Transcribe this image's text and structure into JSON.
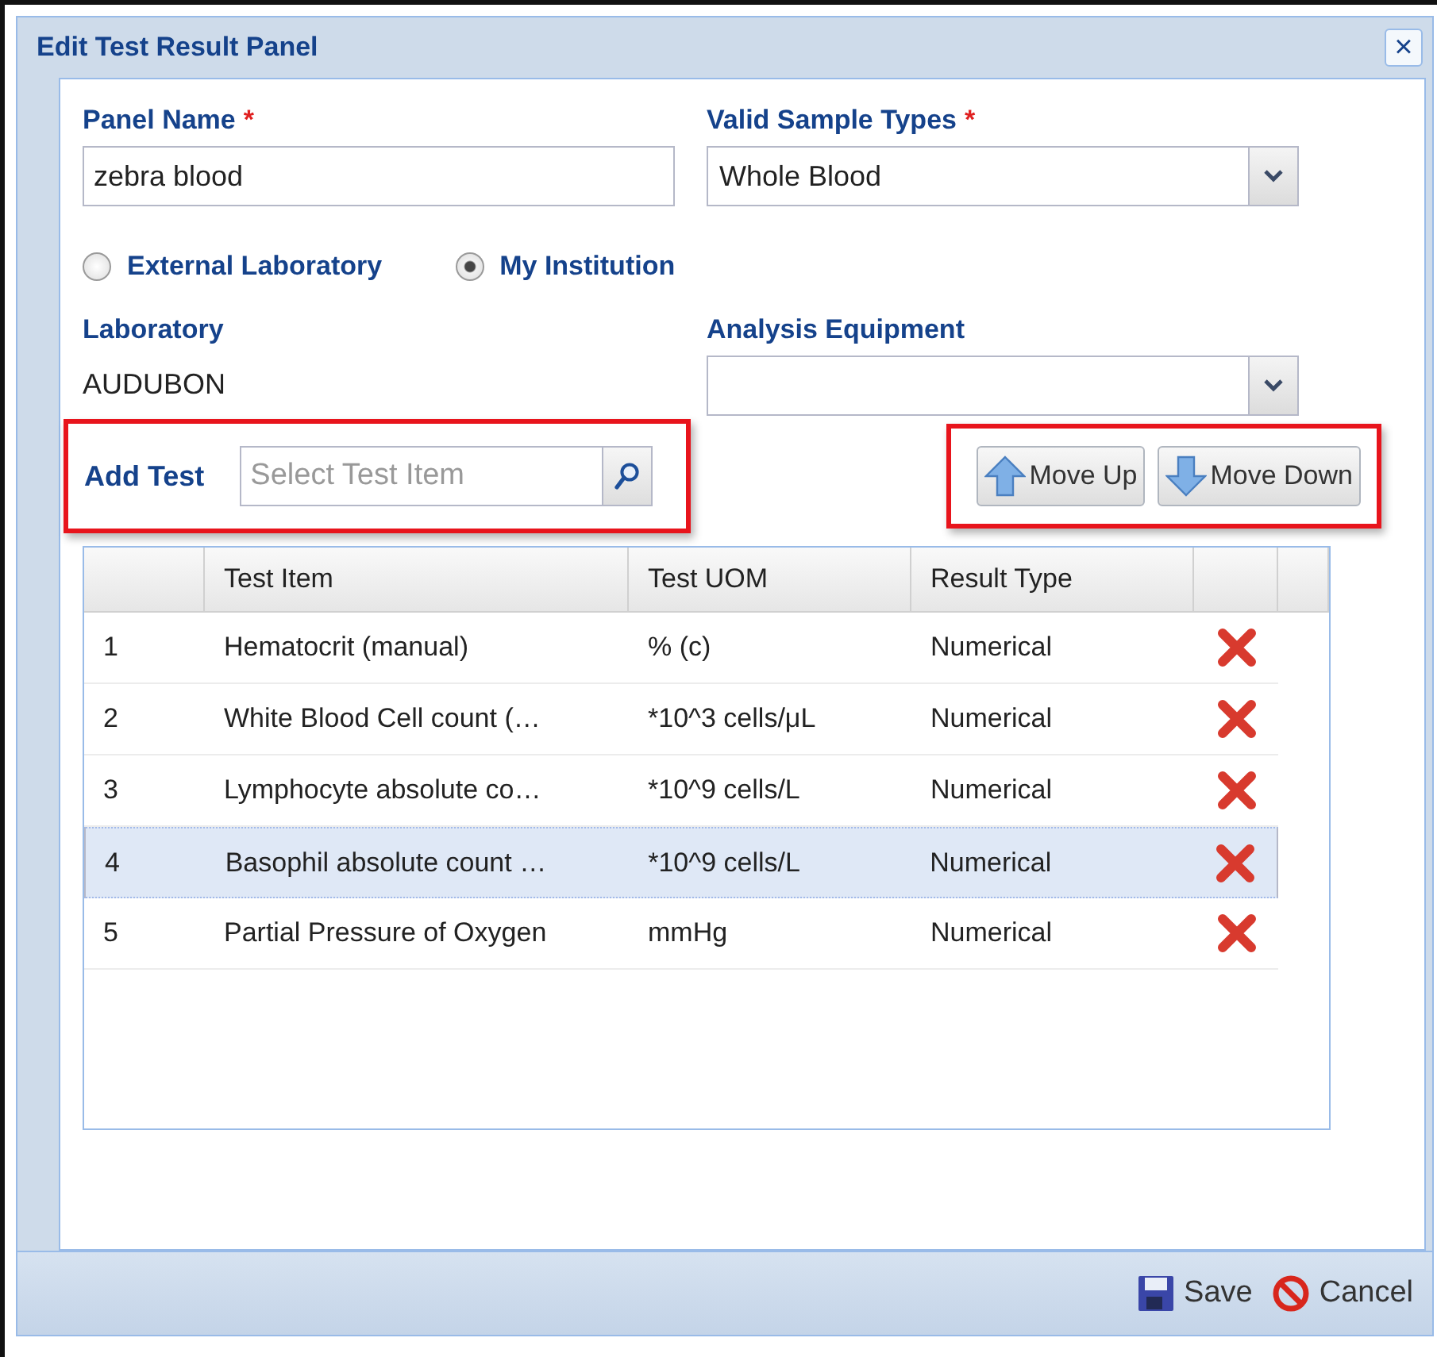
{
  "window": {
    "title": "Edit Test Result Panel",
    "close": "×"
  },
  "panel_name": {
    "label": "Panel Name",
    "required_mark": "*",
    "value": "zebra blood"
  },
  "sample_types": {
    "label": "Valid Sample Types",
    "required_mark": "*",
    "value": "Whole Blood"
  },
  "source": [
    {
      "label": "External Laboratory",
      "selected": false
    },
    {
      "label": "My Institution",
      "selected": true
    }
  ],
  "laboratory": {
    "label": "Laboratory",
    "value": "AUDUBON"
  },
  "equipment": {
    "label": "Analysis Equipment"
  },
  "add_test": {
    "label": "Add Test",
    "placeholder": "Select Test Item"
  },
  "move_buttons": [
    {
      "kind": "up",
      "label": "Move Up"
    },
    {
      "kind": "down",
      "label": "Move Down"
    }
  ],
  "table": {
    "columns": [
      "Test Item",
      "Test UOM",
      "Result Type"
    ],
    "rows": [
      {
        "index": "1",
        "test_item": "Hematocrit (manual)",
        "uom": "% (c)",
        "result_type": "Numerical",
        "selected": false
      },
      {
        "index": "2",
        "test_item": "White Blood Cell count (…",
        "uom": "*10^3 cells/μL",
        "result_type": "Numerical",
        "selected": false
      },
      {
        "index": "3",
        "test_item": "Lymphocyte absolute co…",
        "uom": "*10^9 cells/L",
        "result_type": "Numerical",
        "selected": false
      },
      {
        "index": "4",
        "test_item": "Basophil absolute count …",
        "uom": "*10^9 cells/L",
        "result_type": "Numerical",
        "selected": true
      },
      {
        "index": "5",
        "test_item": "Partial Pressure of Oxygen",
        "uom": "mmHg",
        "result_type": "Numerical",
        "selected": false
      }
    ]
  },
  "footer_buttons": [
    {
      "kind": "save",
      "label": "Save"
    },
    {
      "kind": "cancel",
      "label": "Cancel"
    }
  ]
}
